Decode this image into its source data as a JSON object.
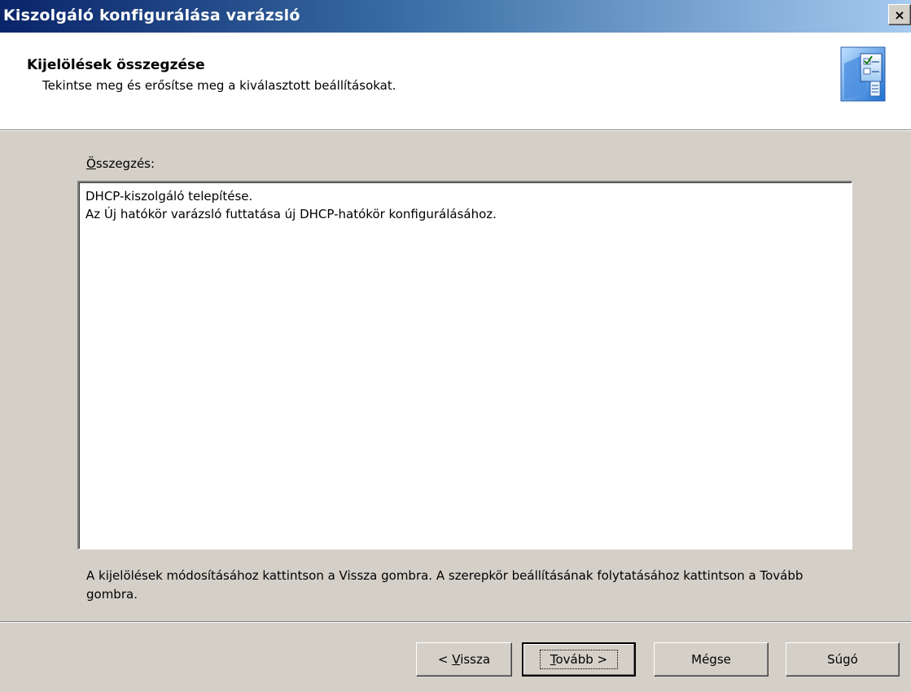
{
  "window": {
    "title": "Kiszolgáló konfigurálása varázsló",
    "close_glyph": "×"
  },
  "header": {
    "title": "Kijelölések összegzése",
    "subtitle": "Tekintse meg és erősítse meg a kiválasztott beállításokat.",
    "icon": "wizard-checklist-icon"
  },
  "summary": {
    "label_access_key": "Ö",
    "label_rest": "sszegzés:",
    "lines": [
      "DHCP-kiszolgáló telepítése.",
      "Az Új hatókör varázsló futtatása új DHCP-hatókör konfigurálásához."
    ]
  },
  "note": "A kijelölések módosításához kattintson a Vissza gombra. A szerepkör beállításának folytatásához kattintson a Tovább gombra.",
  "buttons": {
    "back_prefix": "< ",
    "back_key": "V",
    "back_rest": "issza",
    "next_key": "T",
    "next_rest": "ovább >",
    "cancel": "Mégse",
    "help": "Súgó"
  },
  "colors": {
    "titlebar_start": "#0a246a",
    "titlebar_end": "#a6caf0",
    "dialog_bg": "#d4d0c8",
    "header_bg": "#ffffff"
  }
}
